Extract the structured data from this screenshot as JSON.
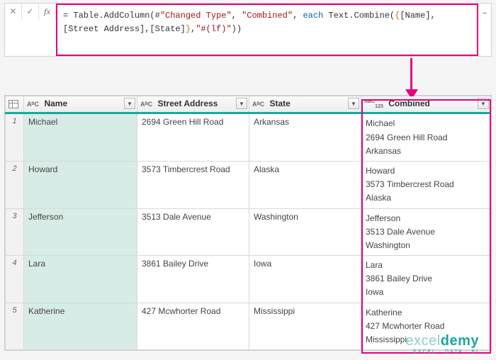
{
  "formula_bar": {
    "cancel_glyph": "✕",
    "confirm_glyph": "✓",
    "fx_label": "fx",
    "expand_glyph": "⌄",
    "eq": "= ",
    "p1": "Table.AddColumn(#",
    "s1": "\"Changed Type\"",
    "p2": ", ",
    "s2": "\"Combined\"",
    "p3": ", ",
    "kw_each": "each",
    "p4": " Text.Combine(",
    "br_open": "{",
    "p5": "[Name],[Street Address],[State]",
    "br_close": "}",
    "p6": ",",
    "s3": "\"#(lf)\"",
    "p7": "))"
  },
  "headers": {
    "name": "Name",
    "street": "Street Address",
    "state": "State",
    "combined": "Combined",
    "abc": "AᴮC",
    "abc123_a": "ABC",
    "abc123_b": "123"
  },
  "rows": [
    {
      "n": "1",
      "name": "Michael",
      "street": "2694 Green Hill Road",
      "state": "Arkansas",
      "combined": [
        "Michael",
        "2694 Green Hill Road",
        "Arkansas"
      ]
    },
    {
      "n": "2",
      "name": "Howard",
      "street": "3573 Timbercrest Road",
      "state": "Alaska",
      "combined": [
        "Howard",
        "3573 Timbercrest Road",
        "Alaska"
      ]
    },
    {
      "n": "3",
      "name": "Jefferson",
      "street": "3513 Dale Avenue",
      "state": "Washington",
      "combined": [
        "Jefferson",
        "3513 Dale Avenue",
        "Washington"
      ]
    },
    {
      "n": "4",
      "name": "Lara",
      "street": "3861 Bailey Drive",
      "state": "Iowa",
      "combined": [
        "Lara",
        "3861 Bailey Drive",
        "Iowa"
      ]
    },
    {
      "n": "5",
      "name": "Katherine",
      "street": "427 Mcwhorter Road",
      "state": "Mississippi",
      "combined": [
        "Katherine",
        "427 Mcwhorter Road",
        "Mississippi"
      ]
    }
  ],
  "watermark": {
    "brand_a": "excel",
    "brand_b": "demy",
    "tag": "EXCEL · DATA · BI"
  }
}
